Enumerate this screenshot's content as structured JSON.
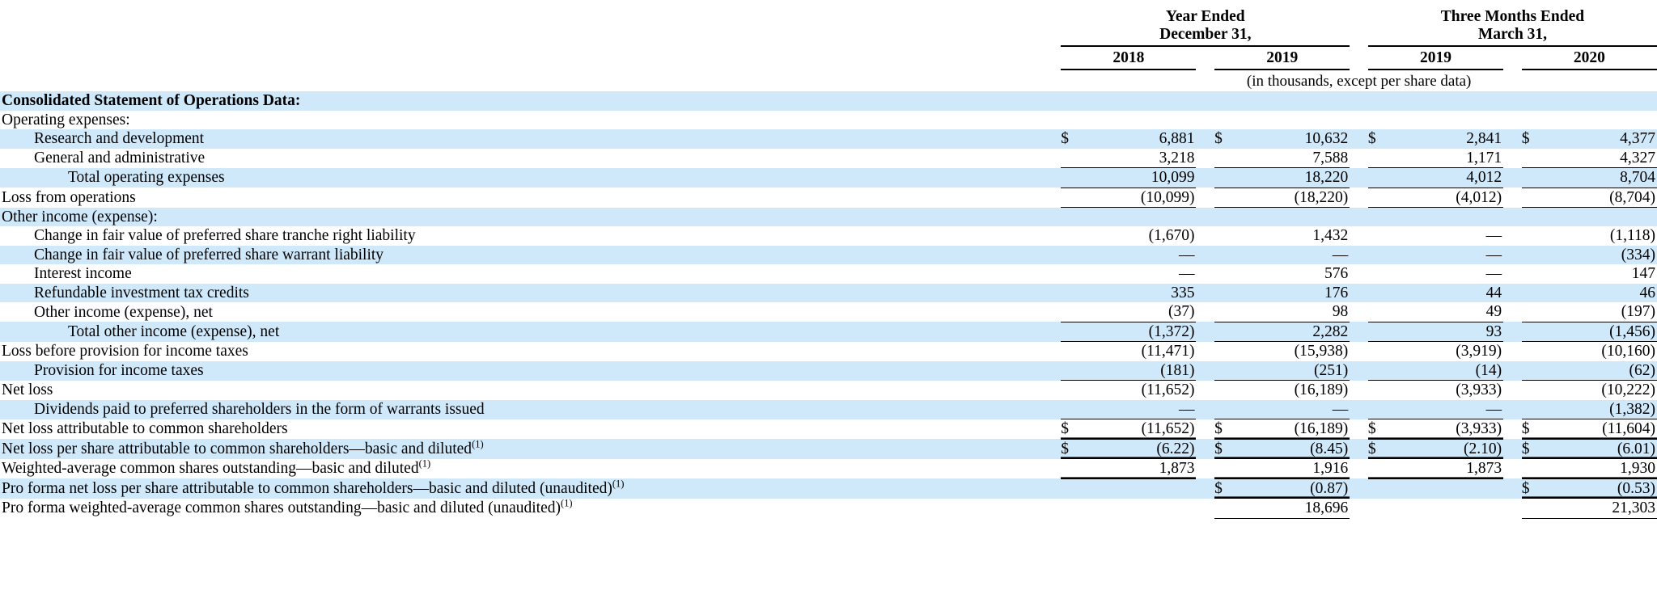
{
  "header": {
    "groups": [
      {
        "title_line1": "Year Ended",
        "title_line2": "December 31,"
      },
      {
        "title_line1": "Three Months Ended",
        "title_line2": "March 31,"
      }
    ],
    "years": [
      "2018",
      "2019",
      "2019",
      "2020"
    ],
    "units_note": "(in thousands, except per share data)"
  },
  "chart_data": {
    "type": "table",
    "title": "Consolidated Statement of Operations Data:",
    "units": "(in thousands, except per share data)",
    "column_groups": [
      "Year Ended December 31,",
      "Three Months Ended March 31,"
    ],
    "columns": [
      "2018",
      "2019",
      "2019",
      "2020"
    ],
    "rows": [
      {
        "label": "Consolidated Statement of Operations Data:",
        "values": [
          "",
          "",
          "",
          ""
        ]
      },
      {
        "label": "Operating expenses:",
        "values": [
          "",
          "",
          "",
          ""
        ]
      },
      {
        "label": "Research and development",
        "values": [
          "6,881",
          "10,632",
          "2,841",
          "4,377"
        ]
      },
      {
        "label": "General and administrative",
        "values": [
          "3,218",
          "7,588",
          "1,171",
          "4,327"
        ]
      },
      {
        "label": "Total operating expenses",
        "values": [
          "10,099",
          "18,220",
          "4,012",
          "8,704"
        ]
      },
      {
        "label": "Loss from operations",
        "values": [
          "(10,099)",
          "(18,220)",
          "(4,012)",
          "(8,704)"
        ]
      },
      {
        "label": "Other income (expense):",
        "values": [
          "",
          "",
          "",
          ""
        ]
      },
      {
        "label": "Change in fair value of preferred share tranche right liability",
        "values": [
          "(1,670)",
          "1,432",
          "—",
          "(1,118)"
        ]
      },
      {
        "label": "Change in fair value of preferred share warrant liability",
        "values": [
          "—",
          "—",
          "—",
          "(334)"
        ]
      },
      {
        "label": "Interest income",
        "values": [
          "—",
          "576",
          "—",
          "147"
        ]
      },
      {
        "label": "Refundable investment tax credits",
        "values": [
          "335",
          "176",
          "44",
          "46"
        ]
      },
      {
        "label": "Other income (expense), net",
        "values": [
          "(37)",
          "98",
          "49",
          "(197)"
        ]
      },
      {
        "label": "Total other income (expense), net",
        "values": [
          "(1,372)",
          "2,282",
          "93",
          "(1,456)"
        ]
      },
      {
        "label": "Loss before provision for income taxes",
        "values": [
          "(11,471)",
          "(15,938)",
          "(3,919)",
          "(10,160)"
        ]
      },
      {
        "label": "Provision for income taxes",
        "values": [
          "(181)",
          "(251)",
          "(14)",
          "(62)"
        ]
      },
      {
        "label": "Net loss",
        "values": [
          "(11,652)",
          "(16,189)",
          "(3,933)",
          "(10,222)"
        ]
      },
      {
        "label": "Dividends paid to preferred shareholders in the form of warrants issued",
        "values": [
          "—",
          "—",
          "—",
          "(1,382)"
        ]
      },
      {
        "label": "Net loss attributable to common shareholders",
        "values": [
          "(11,652)",
          "(16,189)",
          "(3,933)",
          "(11,604)"
        ]
      },
      {
        "label": "Net loss per share attributable to common shareholders—basic and diluted(1)",
        "values": [
          "(6.22)",
          "(8.45)",
          "(2.10)",
          "(6.01)"
        ]
      },
      {
        "label": "Weighted-average common shares outstanding—basic and diluted(1)",
        "values": [
          "1,873",
          "1,916",
          "1,873",
          "1,930"
        ]
      },
      {
        "label": "Pro forma net loss per share attributable to common shareholders—basic and diluted (unaudited)(1)",
        "values": [
          "",
          "(0.87)",
          "",
          "(0.53)"
        ]
      },
      {
        "label": "Pro forma weighted-average common shares outstanding—basic and diluted (unaudited)(1)",
        "values": [
          "",
          "18,696",
          "",
          "21,303"
        ]
      }
    ]
  },
  "rows": {
    "r0": {
      "label": "Consolidated Statement of Operations Data:"
    },
    "r1": {
      "label": "Operating expenses:"
    },
    "r2": {
      "label": "Research and development",
      "c1": "$",
      "v1": "6,881",
      "c2": "$",
      "v2": "10,632",
      "c3": "$",
      "v3": "2,841",
      "c4": "$",
      "v4": "4,377"
    },
    "r3": {
      "label": "General and administrative",
      "c1": "",
      "v1": "3,218",
      "c2": "",
      "v2": "7,588",
      "c3": "",
      "v3": "1,171",
      "c4": "",
      "v4": "4,327"
    },
    "r4": {
      "label": "Total operating expenses",
      "c1": "",
      "v1": "10,099",
      "c2": "",
      "v2": "18,220",
      "c3": "",
      "v3": "4,012",
      "c4": "",
      "v4": "8,704"
    },
    "r5": {
      "label": "Loss from operations",
      "c1": "",
      "v1": "(10,099)",
      "c2": "",
      "v2": "(18,220)",
      "c3": "",
      "v3": "(4,012)",
      "c4": "",
      "v4": "(8,704)"
    },
    "r6": {
      "label": "Other income (expense):"
    },
    "r7": {
      "label": "Change in fair value of preferred share tranche right liability",
      "c1": "",
      "v1": "(1,670)",
      "c2": "",
      "v2": "1,432",
      "c3": "",
      "v3": "—",
      "c4": "",
      "v4": "(1,118)"
    },
    "r8": {
      "label": "Change in fair value of preferred share warrant liability",
      "c1": "",
      "v1": "—",
      "c2": "",
      "v2": "—",
      "c3": "",
      "v3": "—",
      "c4": "",
      "v4": "(334)"
    },
    "r9": {
      "label": "Interest income",
      "c1": "",
      "v1": "—",
      "c2": "",
      "v2": "576",
      "c3": "",
      "v3": "—",
      "c4": "",
      "v4": "147"
    },
    "r10": {
      "label": "Refundable investment tax credits",
      "c1": "",
      "v1": "335",
      "c2": "",
      "v2": "176",
      "c3": "",
      "v3": "44",
      "c4": "",
      "v4": "46"
    },
    "r11": {
      "label": "Other income (expense), net",
      "c1": "",
      "v1": "(37)",
      "c2": "",
      "v2": "98",
      "c3": "",
      "v3": "49",
      "c4": "",
      "v4": "(197)"
    },
    "r12": {
      "label": "Total other income (expense), net",
      "c1": "",
      "v1": "(1,372)",
      "c2": "",
      "v2": "2,282",
      "c3": "",
      "v3": "93",
      "c4": "",
      "v4": "(1,456)"
    },
    "r13": {
      "label": "Loss before provision for income taxes",
      "c1": "",
      "v1": "(11,471)",
      "c2": "",
      "v2": "(15,938)",
      "c3": "",
      "v3": "(3,919)",
      "c4": "",
      "v4": "(10,160)"
    },
    "r14": {
      "label": "Provision for income taxes",
      "c1": "",
      "v1": "(181)",
      "c2": "",
      "v2": "(251)",
      "c3": "",
      "v3": "(14)",
      "c4": "",
      "v4": "(62)"
    },
    "r15": {
      "label": "Net loss",
      "c1": "",
      "v1": "(11,652)",
      "c2": "",
      "v2": "(16,189)",
      "c3": "",
      "v3": "(3,933)",
      "c4": "",
      "v4": "(10,222)"
    },
    "r16": {
      "label": "Dividends paid to preferred shareholders in the form of warrants issued",
      "c1": "",
      "v1": "—",
      "c2": "",
      "v2": "—",
      "c3": "",
      "v3": "—",
      "c4": "",
      "v4": "(1,382)"
    },
    "r17": {
      "label": "Net loss attributable to common shareholders",
      "c1": "$",
      "v1": "(11,652)",
      "c2": "$",
      "v2": "(16,189)",
      "c3": "$",
      "v3": "(3,933)",
      "c4": "$",
      "v4": "(11,604)"
    },
    "r18": {
      "label_main": "Net loss per share attributable to common shareholders—basic and diluted",
      "footnote": "(1)",
      "c1": "$",
      "v1": "(6.22)",
      "c2": "$",
      "v2": "(8.45)",
      "c3": "$",
      "v3": "(2.10)",
      "c4": "$",
      "v4": "(6.01)"
    },
    "r19": {
      "label_main": "Weighted-average common shares outstanding—basic and diluted",
      "footnote": "(1)",
      "c1": "",
      "v1": "1,873",
      "c2": "",
      "v2": "1,916",
      "c3": "",
      "v3": "1,873",
      "c4": "",
      "v4": "1,930"
    },
    "r20": {
      "label_main": "Pro forma net loss per share attributable to common shareholders—basic and diluted (unaudited)",
      "footnote": "(1)",
      "c1": "",
      "v1": "",
      "c2": "$",
      "v2": "(0.87)",
      "c3": "",
      "v3": "",
      "c4": "$",
      "v4": "(0.53)"
    },
    "r21": {
      "label_main": "Pro forma weighted-average common shares outstanding—basic and diluted (unaudited)",
      "footnote": "(1)",
      "c1": "",
      "v1": "",
      "c2": "",
      "v2": "18,696",
      "c3": "",
      "v3": "",
      "c4": "",
      "v4": "21,303"
    }
  },
  "colors": {
    "band": "#cfe9fb",
    "text": "#000000",
    "rule": "#000000"
  }
}
